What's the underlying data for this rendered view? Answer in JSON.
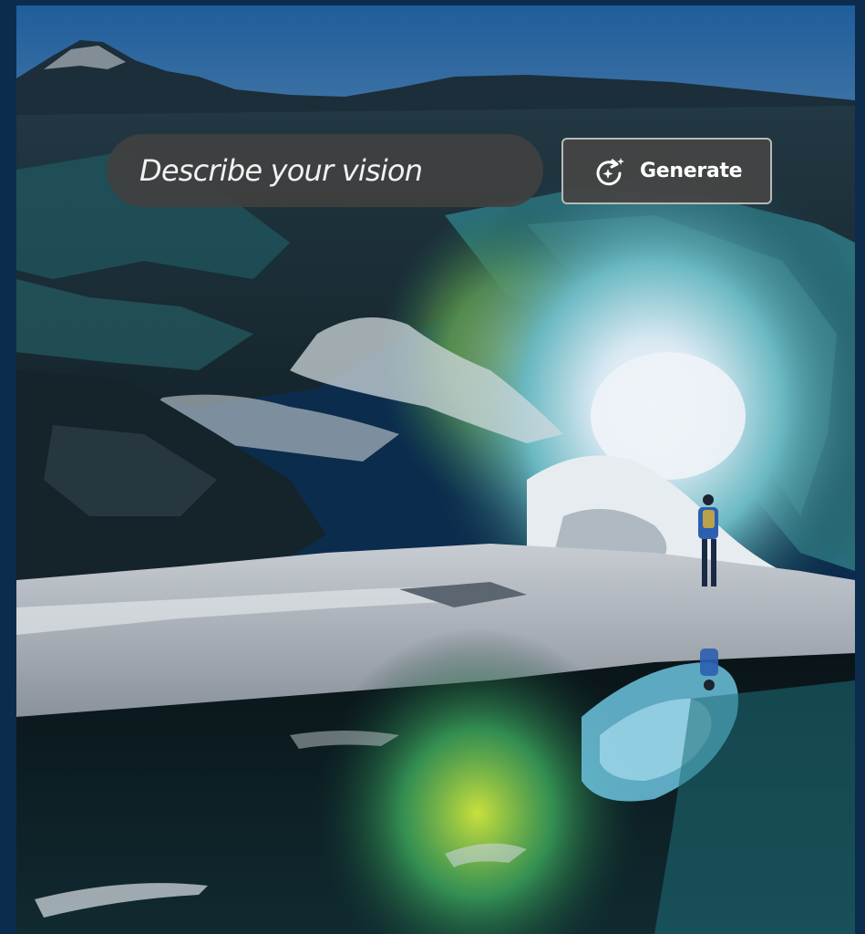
{
  "prompt": {
    "placeholder": "Describe your vision"
  },
  "generate_button": {
    "label": "Generate",
    "icon": "sparkle-refresh-icon"
  },
  "colors": {
    "frame_background": "#0c2c4d",
    "pill_background": "#404040",
    "button_border": "#b9b9b9",
    "text": "#ffffff"
  }
}
